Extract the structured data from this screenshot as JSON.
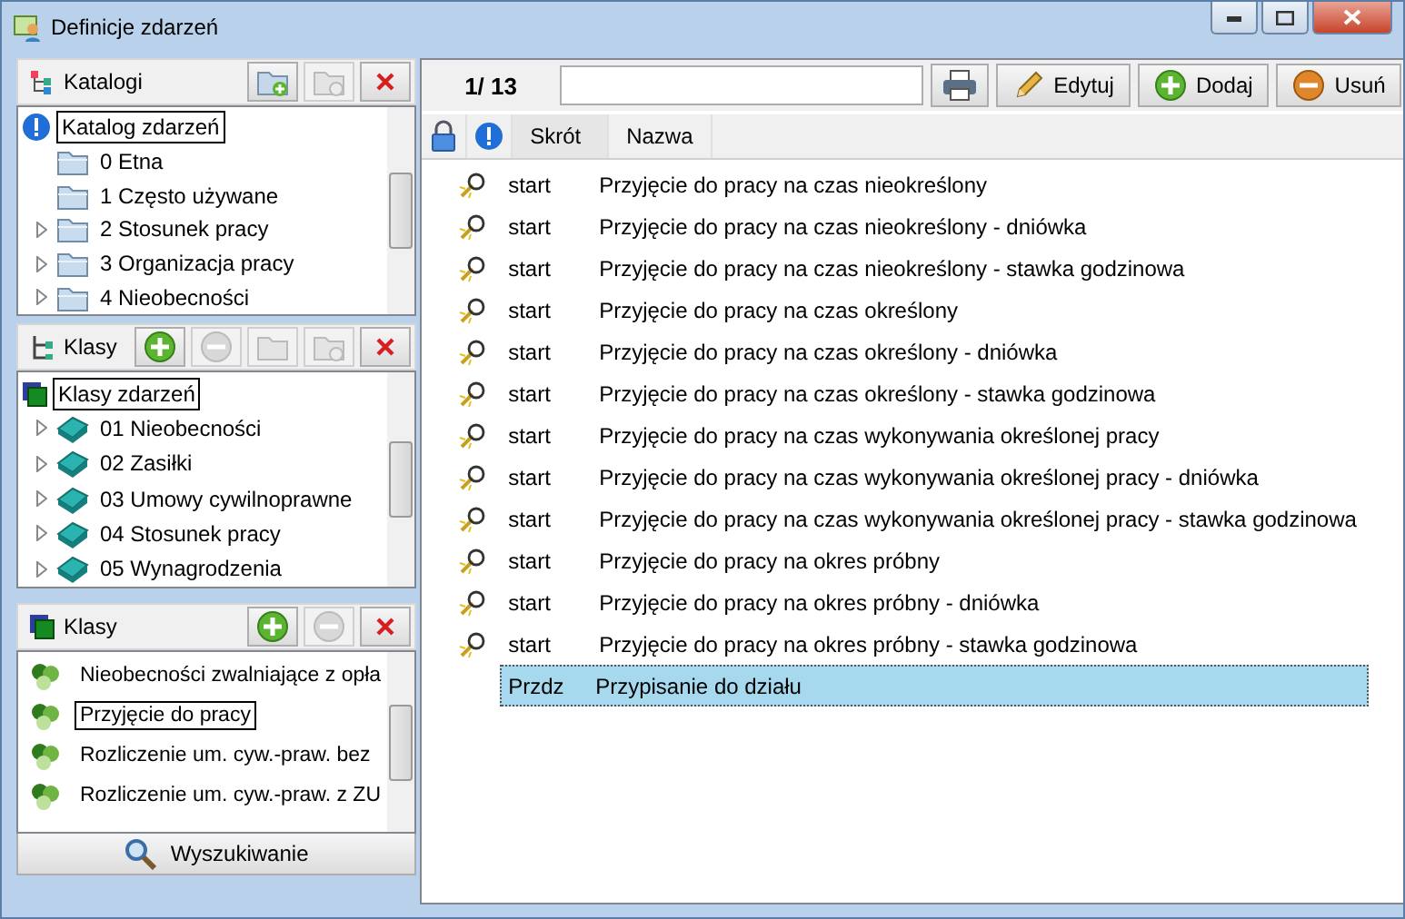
{
  "window": {
    "title": "Definicje zdarzeń"
  },
  "catalogs": {
    "title": "Katalogi",
    "buttons": [
      {
        "kind": "add-folder",
        "disabled": false
      },
      {
        "kind": "remove-folder",
        "disabled": true
      },
      {
        "kind": "close",
        "disabled": false
      }
    ],
    "root": {
      "label": "Katalog zdarzeń",
      "selected": true
    },
    "items": [
      {
        "label": "0 Etna",
        "expandable": false,
        "selected": false
      },
      {
        "label": "1 Często używane",
        "expandable": false,
        "selected": false
      },
      {
        "label": "2 Stosunek pracy",
        "expandable": true,
        "selected": false
      },
      {
        "label": "3 Organizacja pracy",
        "expandable": true,
        "selected": false
      },
      {
        "label": "4 Nieobecności",
        "expandable": true,
        "selected": false
      }
    ]
  },
  "classes": {
    "title": "Klasy",
    "buttons": [
      {
        "kind": "add",
        "disabled": false
      },
      {
        "kind": "remove",
        "disabled": true
      },
      {
        "kind": "add-folder",
        "disabled": true
      },
      {
        "kind": "remove-folder",
        "disabled": true
      },
      {
        "kind": "close",
        "disabled": false
      }
    ],
    "root": {
      "label": "Klasy zdarzeń",
      "selected": true
    },
    "items": [
      {
        "label": "01 Nieobecności",
        "expandable": true,
        "selected": false
      },
      {
        "label": "02 Zasiłki",
        "expandable": true,
        "selected": false
      },
      {
        "label": "03 Umowy cywilnoprawne",
        "expandable": true,
        "selected": false
      },
      {
        "label": "04 Stosunek pracy",
        "expandable": true,
        "selected": false
      },
      {
        "label": "05 Wynagrodzenia",
        "expandable": true,
        "selected": false
      }
    ]
  },
  "class_list": {
    "title": "Klasy",
    "buttons": [
      {
        "kind": "add",
        "disabled": false
      },
      {
        "kind": "remove",
        "disabled": true
      },
      {
        "kind": "close",
        "disabled": false
      }
    ],
    "items": [
      {
        "label": "Nieobecności zwalniające z opła",
        "selected": false
      },
      {
        "label": "Przyjęcie do pracy",
        "selected": true
      },
      {
        "label": "Rozliczenie um. cyw.-praw. bez",
        "selected": false
      },
      {
        "label": "Rozliczenie um. cyw.-praw. z ZU",
        "selected": false
      }
    ]
  },
  "search_button": {
    "label": "Wyszukiwanie"
  },
  "toolbar": {
    "counter": "1/ 13",
    "buttons": [
      {
        "kind": "print"
      },
      {
        "kind": "edit",
        "label": "Edytuj"
      },
      {
        "kind": "add",
        "label": "Dodaj"
      },
      {
        "kind": "remove",
        "label": "Usuń"
      }
    ]
  },
  "table": {
    "columns": [
      {
        "kind": "lock"
      },
      {
        "kind": "info"
      },
      {
        "kind": "text",
        "label": "Skrót"
      },
      {
        "kind": "text",
        "label": "Nazwa"
      }
    ],
    "rows": [
      {
        "marked": true,
        "code": "start",
        "name": "Przyjęcie do pracy na czas nieokreślony",
        "selected": false
      },
      {
        "marked": true,
        "code": "start",
        "name": "Przyjęcie do pracy na czas nieokreślony - dniówka",
        "selected": false
      },
      {
        "marked": true,
        "code": "start",
        "name": "Przyjęcie do pracy na czas nieokreślony - stawka godzinowa",
        "selected": false
      },
      {
        "marked": true,
        "code": "start",
        "name": "Przyjęcie do pracy na czas określony",
        "selected": false
      },
      {
        "marked": true,
        "code": "start",
        "name": "Przyjęcie do pracy na czas określony - dniówka",
        "selected": false
      },
      {
        "marked": true,
        "code": "start",
        "name": "Przyjęcie do pracy na czas określony - stawka godzinowa",
        "selected": false
      },
      {
        "marked": true,
        "code": "start",
        "name": "Przyjęcie do pracy na czas wykonywania określonej pracy",
        "selected": false
      },
      {
        "marked": true,
        "code": "start",
        "name": "Przyjęcie do pracy na czas wykonywania określonej pracy - dniówka",
        "selected": false
      },
      {
        "marked": true,
        "code": "start",
        "name": "Przyjęcie do pracy na czas wykonywania określonej pracy - stawka godzinowa",
        "selected": false
      },
      {
        "marked": true,
        "code": "start",
        "name": "Przyjęcie do pracy na okres próbny",
        "selected": false
      },
      {
        "marked": true,
        "code": "start",
        "name": "Przyjęcie do pracy na okres próbny - dniówka",
        "selected": false
      },
      {
        "marked": true,
        "code": "start",
        "name": "Przyjęcie do pracy na okres próbny - stawka godzinowa",
        "selected": false
      },
      {
        "marked": false,
        "code": "Przdz",
        "name": "Przypisanie do działu",
        "selected": true
      }
    ]
  }
}
